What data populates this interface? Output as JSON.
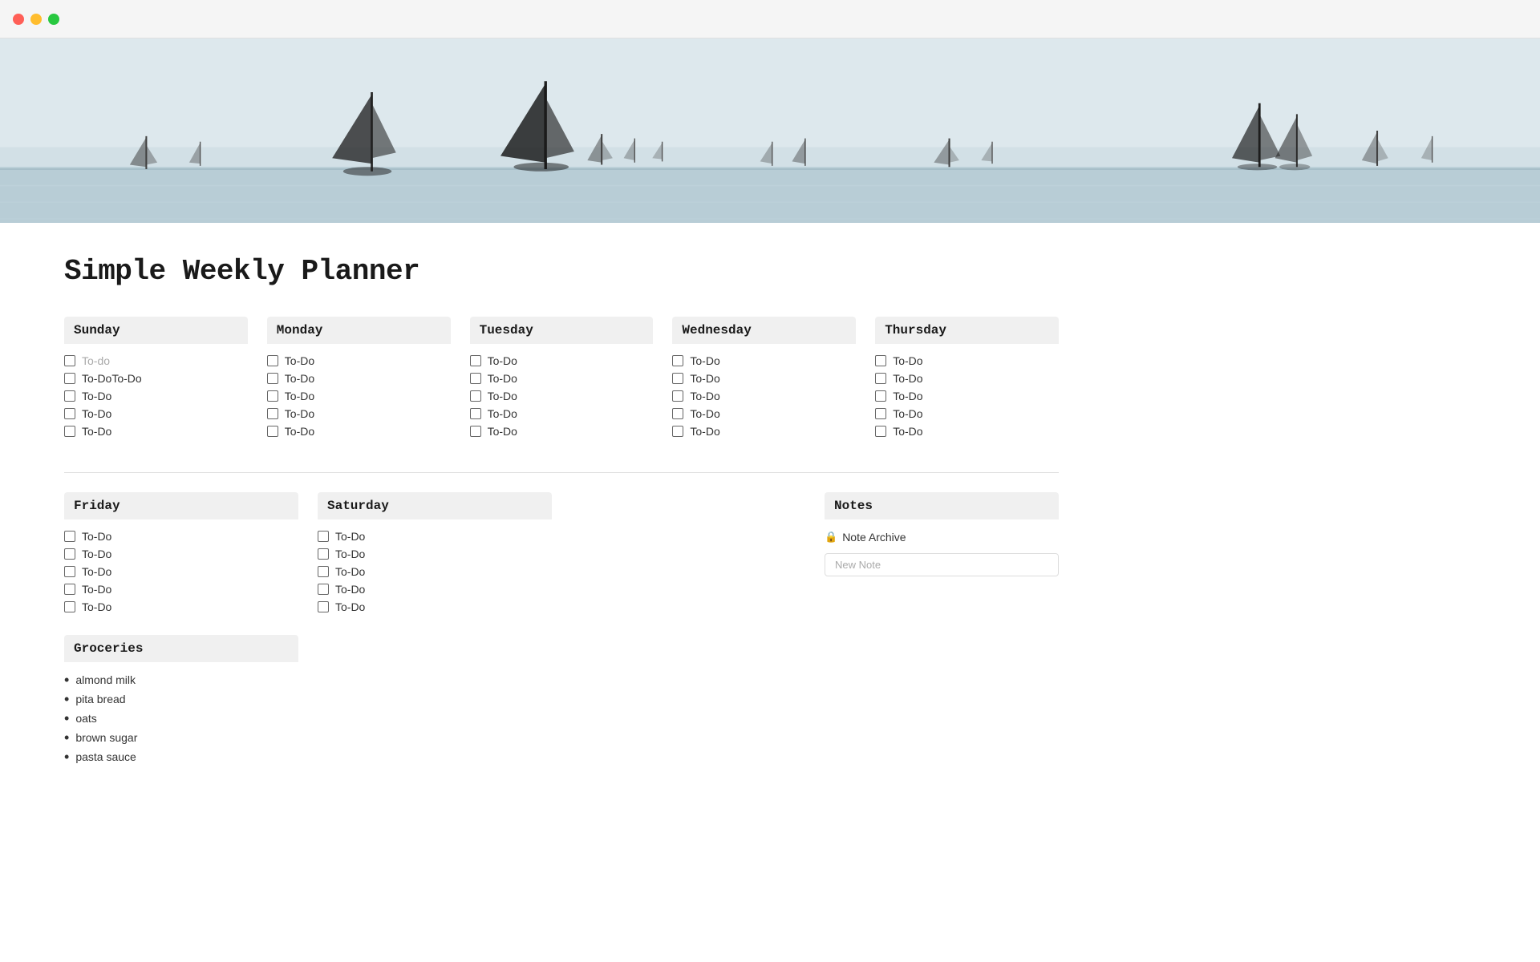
{
  "titlebar": {
    "close": "close",
    "minimize": "minimize",
    "maximize": "maximize"
  },
  "page": {
    "title": "Simple Weekly Planner"
  },
  "days_top": [
    {
      "name": "Sunday",
      "todos": [
        {
          "text": "To-do",
          "placeholder": true
        },
        {
          "text": "To-DoTo-Do",
          "placeholder": false
        },
        {
          "text": "To-Do",
          "placeholder": false
        },
        {
          "text": "To-Do",
          "placeholder": false
        },
        {
          "text": "To-Do",
          "placeholder": false
        }
      ]
    },
    {
      "name": "Monday",
      "todos": [
        {
          "text": "To-Do",
          "placeholder": false
        },
        {
          "text": "To-Do",
          "placeholder": false
        },
        {
          "text": "To-Do",
          "placeholder": false
        },
        {
          "text": "To-Do",
          "placeholder": false
        },
        {
          "text": "To-Do",
          "placeholder": false
        }
      ]
    },
    {
      "name": "Tuesday",
      "todos": [
        {
          "text": "To-Do",
          "placeholder": false
        },
        {
          "text": "To-Do",
          "placeholder": false
        },
        {
          "text": "To-Do",
          "placeholder": false
        },
        {
          "text": "To-Do",
          "placeholder": false
        },
        {
          "text": "To-Do",
          "placeholder": false
        }
      ]
    },
    {
      "name": "Wednesday",
      "todos": [
        {
          "text": "To-Do",
          "placeholder": false
        },
        {
          "text": "To-Do",
          "placeholder": false
        },
        {
          "text": "To-Do",
          "placeholder": false
        },
        {
          "text": "To-Do",
          "placeholder": false
        },
        {
          "text": "To-Do",
          "placeholder": false
        }
      ]
    },
    {
      "name": "Thursday",
      "todos": [
        {
          "text": "To-Do",
          "placeholder": false
        },
        {
          "text": "To-Do",
          "placeholder": false
        },
        {
          "text": "To-Do",
          "placeholder": false
        },
        {
          "text": "To-Do",
          "placeholder": false
        },
        {
          "text": "To-Do",
          "placeholder": false
        }
      ]
    }
  ],
  "days_bottom": [
    {
      "name": "Friday",
      "todos": [
        {
          "text": "To-Do",
          "placeholder": false
        },
        {
          "text": "To-Do",
          "placeholder": false
        },
        {
          "text": "To-Do",
          "placeholder": false
        },
        {
          "text": "To-Do",
          "placeholder": false
        },
        {
          "text": "To-Do",
          "placeholder": false
        }
      ]
    },
    {
      "name": "Saturday",
      "todos": [
        {
          "text": "To-Do",
          "placeholder": false
        },
        {
          "text": "To-Do",
          "placeholder": false
        },
        {
          "text": "To-Do",
          "placeholder": false
        },
        {
          "text": "To-Do",
          "placeholder": false
        },
        {
          "text": "To-Do",
          "placeholder": false
        }
      ]
    }
  ],
  "notes": {
    "header": "Notes",
    "archive_label": "Note Archive",
    "new_note_placeholder": "New Note"
  },
  "groceries": {
    "header": "Groceries",
    "items": [
      "almond milk",
      "pita bread",
      "oats",
      "brown sugar",
      "pasta sauce"
    ]
  }
}
